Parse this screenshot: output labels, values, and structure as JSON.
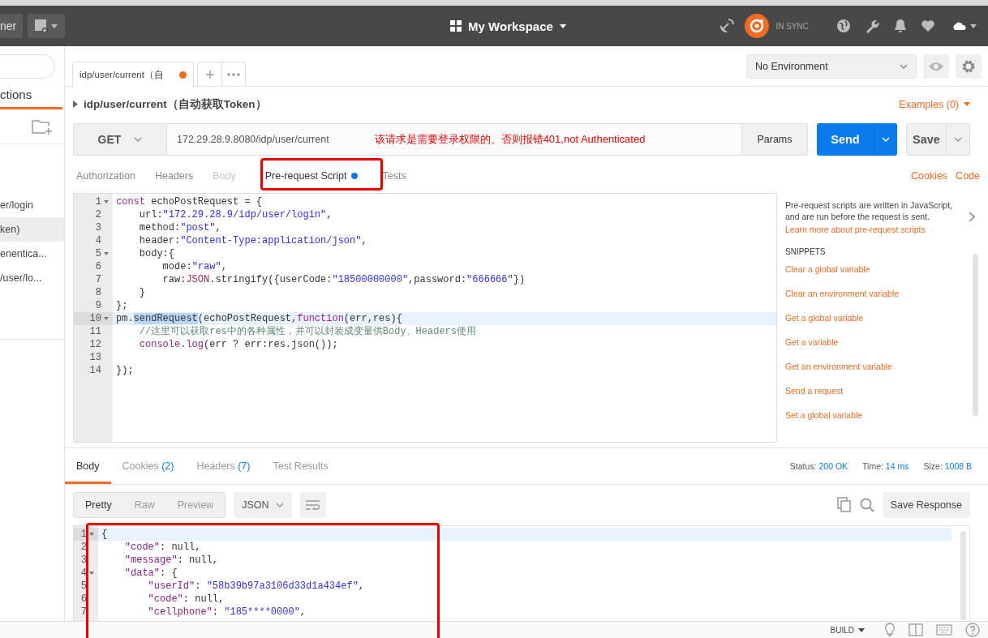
{
  "topbar": {
    "left_button": "ner",
    "workspace": "My Workspace",
    "sync_status": "IN SYNC"
  },
  "sidebar": {
    "tab": "ctions",
    "items": [
      {
        "label": "er/login",
        "selected": false
      },
      {
        "label": "ken)",
        "selected": true
      },
      {
        "label": "enentica...",
        "selected": false
      },
      {
        "label": "/user/lo...",
        "selected": false
      }
    ]
  },
  "request_tabs": [
    {
      "label": "idp/user/current（自",
      "unsaved": true,
      "selected": true
    }
  ],
  "environment": {
    "value": "No Environment"
  },
  "request": {
    "name": "idp/user/current（自动获取Token）",
    "examples": "Examples (0)",
    "method": "GET",
    "url": "172.29.28.9.8080/idp/user/current",
    "note": "该请求是需要登录权限的、否则报错401,not Authenticated",
    "params": "Params",
    "send": "Send",
    "save": "Save"
  },
  "request_subtabs": [
    {
      "label": "Authorization",
      "selected": false,
      "disabled": false,
      "dot": false
    },
    {
      "label": "Headers",
      "selected": false,
      "disabled": false,
      "dot": false
    },
    {
      "label": "Body",
      "selected": false,
      "disabled": true,
      "dot": false
    },
    {
      "label": "Pre-request Script",
      "selected": true,
      "disabled": false,
      "dot": true
    },
    {
      "label": "Tests",
      "selected": false,
      "disabled": false,
      "dot": false
    }
  ],
  "request_links": [
    "Cookies",
    "Code"
  ],
  "script": {
    "lines": [
      {
        "n": "1",
        "fold": true,
        "active": false,
        "tokens": [
          {
            "kind": "kw",
            "text": "const"
          },
          {
            "kind": "p",
            "text": " echoPostRequest = {"
          }
        ]
      },
      {
        "n": "2",
        "fold": false,
        "active": false,
        "tokens": [
          {
            "kind": "p",
            "text": "    url:"
          },
          {
            "kind": "str",
            "text": "\"172.29.28.9/idp/user/login\""
          },
          {
            "kind": "p",
            "text": ","
          }
        ]
      },
      {
        "n": "3",
        "fold": false,
        "active": false,
        "tokens": [
          {
            "kind": "p",
            "text": "    method:"
          },
          {
            "kind": "str",
            "text": "\"post\""
          },
          {
            "kind": "p",
            "text": ","
          }
        ]
      },
      {
        "n": "4",
        "fold": false,
        "active": false,
        "tokens": [
          {
            "kind": "p",
            "text": "    header:"
          },
          {
            "kind": "str",
            "text": "\"Content-Type:application/json\""
          },
          {
            "kind": "p",
            "text": ","
          }
        ]
      },
      {
        "n": "5",
        "fold": true,
        "active": false,
        "tokens": [
          {
            "kind": "p",
            "text": "    body:{"
          }
        ]
      },
      {
        "n": "6",
        "fold": false,
        "active": false,
        "tokens": [
          {
            "kind": "p",
            "text": "        mode:"
          },
          {
            "kind": "str",
            "text": "\"raw\""
          },
          {
            "kind": "p",
            "text": ","
          }
        ]
      },
      {
        "n": "7",
        "fold": false,
        "active": false,
        "tokens": [
          {
            "kind": "p",
            "text": "        raw:"
          },
          {
            "kind": "obj",
            "text": "JSON"
          },
          {
            "kind": "p",
            "text": ".stringify({userCode:"
          },
          {
            "kind": "str",
            "text": "\"18500000000\""
          },
          {
            "kind": "p",
            "text": ",password:"
          },
          {
            "kind": "str",
            "text": "\"666666\""
          },
          {
            "kind": "p",
            "text": "})"
          }
        ]
      },
      {
        "n": "8",
        "fold": false,
        "active": false,
        "tokens": [
          {
            "kind": "p",
            "text": "    }"
          }
        ]
      },
      {
        "n": "9",
        "fold": false,
        "active": false,
        "tokens": [
          {
            "kind": "p",
            "text": "};"
          }
        ]
      },
      {
        "n": "10",
        "fold": true,
        "active": true,
        "tokens": [
          {
            "kind": "p",
            "text": "pm."
          },
          {
            "kind": "sel",
            "text": "sendRequest"
          },
          {
            "kind": "p",
            "text": "(echoPostRequest,"
          },
          {
            "kind": "kw",
            "text": "function"
          },
          {
            "kind": "p",
            "text": "(err,res){"
          }
        ]
      },
      {
        "n": "11",
        "fold": false,
        "active": false,
        "tokens": [
          {
            "kind": "com",
            "text": "    //这里可以获取res中的各种属性，并可以封装成变量供Body、Headers使用"
          }
        ]
      },
      {
        "n": "12",
        "fold": false,
        "active": false,
        "tokens": [
          {
            "kind": "kw",
            "text": "    console"
          },
          {
            "kind": "p",
            "text": "."
          },
          {
            "kind": "kw",
            "text": "log"
          },
          {
            "kind": "p",
            "text": "(err ? err:res.json());"
          }
        ]
      },
      {
        "n": "13",
        "fold": false,
        "active": false
      },
      {
        "n": "14",
        "fold": false,
        "active": false,
        "tokens": [
          {
            "kind": "p",
            "text": "});"
          }
        ]
      }
    ]
  },
  "help": {
    "description": "Pre-request scripts are written in JavaScript, and are run before the request is sent.",
    "link": "Learn more about pre-request scripts",
    "snippets_title": "SNIPPETS",
    "snippets": [
      "Clear a global variable",
      "Clear an environment variable",
      "Get a global variable",
      "Get a variable",
      "Get an environment variable",
      "Send a request",
      "Set a global variable"
    ]
  },
  "response": {
    "tabs": [
      {
        "label": "Body",
        "selected": true
      },
      {
        "label": "Cookies",
        "count": "(2)",
        "selected": false
      },
      {
        "label": "Headers",
        "count": "(7)",
        "selected": false
      },
      {
        "label": "Test Results",
        "selected": false
      }
    ],
    "stats": [
      {
        "label": "Status:",
        "value": "200 OK"
      },
      {
        "label": "Time:",
        "value": "14 ms"
      },
      {
        "label": "Size:",
        "value": "1008 B"
      }
    ],
    "view_modes": [
      {
        "label": "Pretty",
        "selected": true
      },
      {
        "label": "Raw",
        "selected": false
      },
      {
        "label": "Preview",
        "selected": false
      }
    ],
    "format": "JSON",
    "save_response": "Save Response",
    "lines": [
      {
        "n": "1",
        "fold": true,
        "active": true,
        "tokens": [
          {
            "kind": "p",
            "text": "{"
          }
        ]
      },
      {
        "n": "2",
        "fold": false,
        "active": false,
        "tokens": [
          {
            "kind": "key",
            "text": "    \"code\""
          },
          {
            "kind": "p",
            "text": ": null,"
          }
        ]
      },
      {
        "n": "3",
        "fold": false,
        "active": false,
        "tokens": [
          {
            "kind": "key",
            "text": "    \"message\""
          },
          {
            "kind": "p",
            "text": ": null,"
          }
        ]
      },
      {
        "n": "4",
        "fold": true,
        "active": false,
        "tokens": [
          {
            "kind": "key",
            "text": "    \"data\""
          },
          {
            "kind": "p",
            "text": ": {"
          }
        ]
      },
      {
        "n": "5",
        "fold": false,
        "active": false,
        "tokens": [
          {
            "kind": "key",
            "text": "        \"userId\""
          },
          {
            "kind": "p",
            "text": ": "
          },
          {
            "kind": "str",
            "text": "\"58b39b97a3106d33d1a434ef\""
          },
          {
            "kind": "p",
            "text": ","
          }
        ]
      },
      {
        "n": "6",
        "fold": false,
        "active": false,
        "tokens": [
          {
            "kind": "key",
            "text": "        \"code\""
          },
          {
            "kind": "p",
            "text": ": null,"
          }
        ]
      },
      {
        "n": "7",
        "fold": false,
        "active": false,
        "tokens": [
          {
            "kind": "key",
            "text": "        \"cellphone\""
          },
          {
            "kind": "p",
            "text": ": "
          },
          {
            "kind": "str",
            "text": "\"185****0000\""
          },
          {
            "kind": "p",
            "text": ","
          }
        ]
      }
    ]
  },
  "footer": {
    "build": "BUILD"
  }
}
